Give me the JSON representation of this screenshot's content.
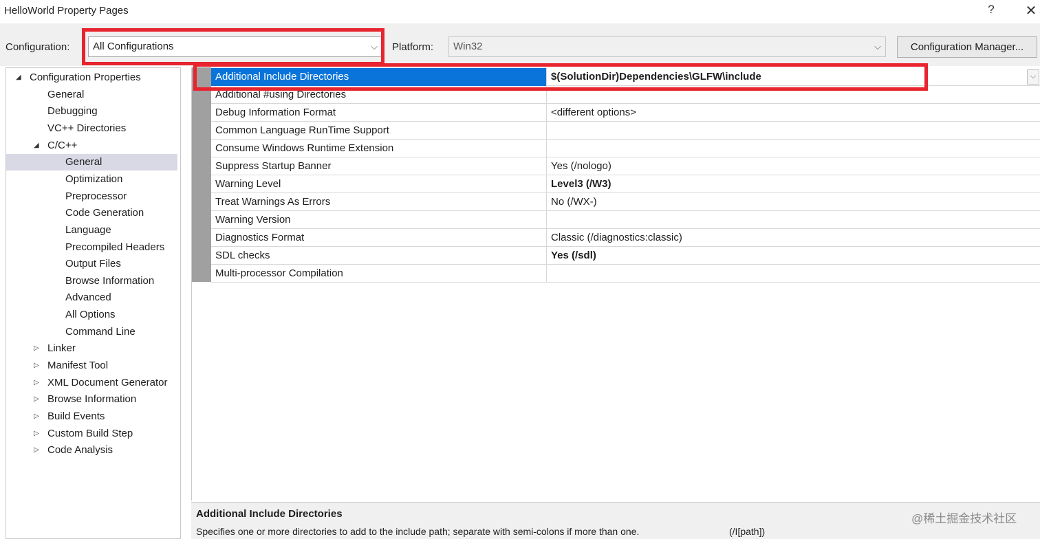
{
  "window": {
    "title": "HelloWorld Property Pages",
    "help_glyph": "?",
    "close_glyph": "✕"
  },
  "config_bar": {
    "configuration_label": "Configuration:",
    "configuration_value": "All Configurations",
    "platform_label": "Platform:",
    "platform_value": "Win32",
    "config_manager_label": "Configuration Manager..."
  },
  "tree": {
    "items": [
      {
        "label": "Configuration Properties",
        "expander": "◢"
      },
      {
        "label": "General"
      },
      {
        "label": "Debugging"
      },
      {
        "label": "VC++ Directories"
      },
      {
        "label": "C/C++",
        "expander": "◢"
      },
      {
        "label": "General",
        "selected": true
      },
      {
        "label": "Optimization"
      },
      {
        "label": "Preprocessor"
      },
      {
        "label": "Code Generation"
      },
      {
        "label": "Language"
      },
      {
        "label": "Precompiled Headers"
      },
      {
        "label": "Output Files"
      },
      {
        "label": "Browse Information"
      },
      {
        "label": "Advanced"
      },
      {
        "label": "All Options"
      },
      {
        "label": "Command Line"
      },
      {
        "label": "Linker",
        "expander": "▷"
      },
      {
        "label": "Manifest Tool",
        "expander": "▷"
      },
      {
        "label": "XML Document Generator",
        "expander": "▷"
      },
      {
        "label": "Browse Information",
        "expander": "▷"
      },
      {
        "label": "Build Events",
        "expander": "▷"
      },
      {
        "label": "Custom Build Step",
        "expander": "▷"
      },
      {
        "label": "Code Analysis",
        "expander": "▷"
      }
    ]
  },
  "properties": [
    {
      "name": "Additional Include Directories",
      "value": "$(SolutionDir)Dependencies\\GLFW\\include",
      "bold": true,
      "selected": true
    },
    {
      "name": "Additional #using Directories",
      "value": ""
    },
    {
      "name": "Debug Information Format",
      "value": "<different options>"
    },
    {
      "name": "Common Language RunTime Support",
      "value": ""
    },
    {
      "name": "Consume Windows Runtime Extension",
      "value": ""
    },
    {
      "name": "Suppress Startup Banner",
      "value": "Yes (/nologo)"
    },
    {
      "name": "Warning Level",
      "value": "Level3 (/W3)",
      "bold": true
    },
    {
      "name": "Treat Warnings As Errors",
      "value": "No (/WX-)"
    },
    {
      "name": "Warning Version",
      "value": ""
    },
    {
      "name": "Diagnostics Format",
      "value": "Classic (/diagnostics:classic)"
    },
    {
      "name": "SDL checks",
      "value": "Yes (/sdl)",
      "bold": true
    },
    {
      "name": "Multi-processor Compilation",
      "value": ""
    }
  ],
  "description": {
    "title": "Additional Include Directories",
    "text": "Specifies one or more directories to add to the include path; separate with semi-colons if more than one.",
    "switch": "(/I[path])"
  },
  "watermark": "@稀土掘金技术社区",
  "colors": {
    "highlight_red": "#e8242f",
    "selection_blue": "#0a74da",
    "tree_selection": "#d9d9e6",
    "dialog_gray": "#f0f0f0"
  }
}
